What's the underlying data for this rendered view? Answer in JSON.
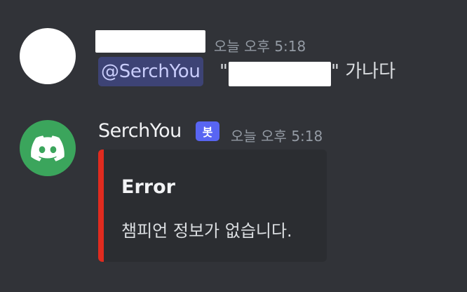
{
  "messages": [
    {
      "author": "",
      "author_redacted": true,
      "timestamp": "오늘 오후 5:18",
      "mention": "@SerchYou",
      "quote_open": "\"",
      "quote_content_redacted": true,
      "quote_close_and_text": "\" 가나다"
    },
    {
      "author": "SerchYou",
      "bot_tag": "봇",
      "timestamp": "오늘 오후 5:18",
      "avatar_icon": "discord-logo-icon",
      "embed": {
        "accent_color": "#e02b1f",
        "title": "Error",
        "description": "챔피언 정보가 없습니다."
      }
    }
  ],
  "colors": {
    "background": "#313338",
    "bot_avatar": "#3ba55c",
    "bot_tag": "#5865f2",
    "mention_bg": "#5865f254",
    "embed_bg": "#2b2d31"
  }
}
